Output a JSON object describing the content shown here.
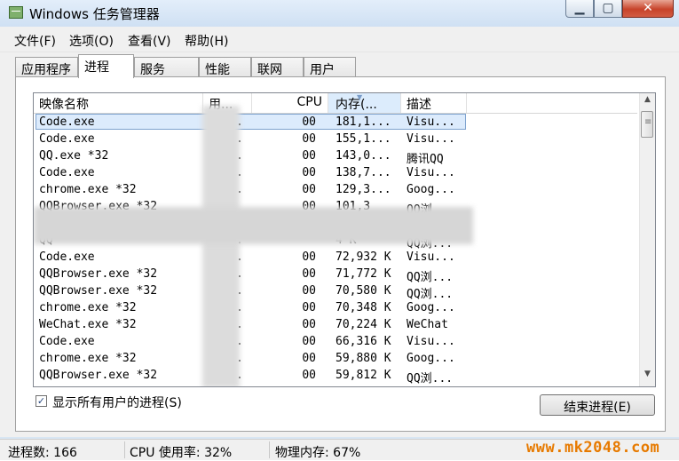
{
  "window": {
    "title": "Windows 任务管理器",
    "icon": "task-manager-icon"
  },
  "menu": [
    "文件(F)",
    "选项(O)",
    "查看(V)",
    "帮助(H)"
  ],
  "tabs": [
    {
      "label": "应用程序",
      "active": false
    },
    {
      "label": "进程",
      "active": true
    },
    {
      "label": "服务",
      "active": false
    },
    {
      "label": "性能",
      "active": false
    },
    {
      "label": "联网",
      "active": false
    },
    {
      "label": "用户",
      "active": false
    }
  ],
  "table": {
    "columns": [
      "映像名称",
      "用...",
      "CPU",
      "内存(...",
      "描述"
    ],
    "rows": [
      {
        "name": "Code.exe",
        "user": ".",
        "cpu": "00",
        "mem": "181,1...",
        "desc": "Visu...",
        "selected": true
      },
      {
        "name": "Code.exe",
        "user": ".",
        "cpu": "00",
        "mem": "155,1...",
        "desc": "Visu..."
      },
      {
        "name": "QQ.exe *32",
        "user": ".",
        "cpu": "00",
        "mem": "143,0...",
        "desc": "腾讯QQ"
      },
      {
        "name": "Code.exe",
        "user": ".",
        "cpu": "00",
        "mem": "138,7...",
        "desc": "Visu..."
      },
      {
        "name": "chrome.exe *32",
        "user": ".",
        "cpu": "00",
        "mem": "129,3...",
        "desc": "Goog..."
      },
      {
        "name": "QQBrowser.exe *32",
        "user": "",
        "cpu": "00",
        "mem": "101,3",
        "desc": "QQ浏"
      },
      {
        "name": "",
        "user": "",
        "cpu": "",
        "mem": "",
        "desc": ""
      },
      {
        "name": "QQ",
        "user": ".",
        "cpu": "",
        "mem": "4 K",
        "desc": "QQ浏..."
      },
      {
        "name": "Code.exe",
        "user": ".",
        "cpu": "00",
        "mem": "72,932 K",
        "desc": "Visu..."
      },
      {
        "name": "QQBrowser.exe *32",
        "user": ".",
        "cpu": "00",
        "mem": "71,772 K",
        "desc": "QQ浏..."
      },
      {
        "name": "QQBrowser.exe *32",
        "user": ".",
        "cpu": "00",
        "mem": "70,580 K",
        "desc": "QQ浏..."
      },
      {
        "name": "chrome.exe *32",
        "user": ".",
        "cpu": "00",
        "mem": "70,348 K",
        "desc": "Goog..."
      },
      {
        "name": "WeChat.exe *32",
        "user": ".",
        "cpu": "00",
        "mem": "70,224 K",
        "desc": "WeChat"
      },
      {
        "name": "Code.exe",
        "user": ".",
        "cpu": "00",
        "mem": "66,316 K",
        "desc": "Visu..."
      },
      {
        "name": "chrome.exe *32",
        "user": ".",
        "cpu": "00",
        "mem": "59,880 K",
        "desc": "Goog..."
      },
      {
        "name": "QQBrowser.exe *32",
        "user": ".",
        "cpu": "00",
        "mem": "59,812 K",
        "desc": "QQ浏..."
      }
    ]
  },
  "show_all_users": {
    "label": "显示所有用户的进程(S)",
    "checked": true
  },
  "end_process_label": "结束进程(E)",
  "status": {
    "processes": "进程数: 166",
    "cpu": "CPU 使用率: 32%",
    "memory": "物理内存: 67%"
  },
  "watermark": "www.mk2048.com"
}
